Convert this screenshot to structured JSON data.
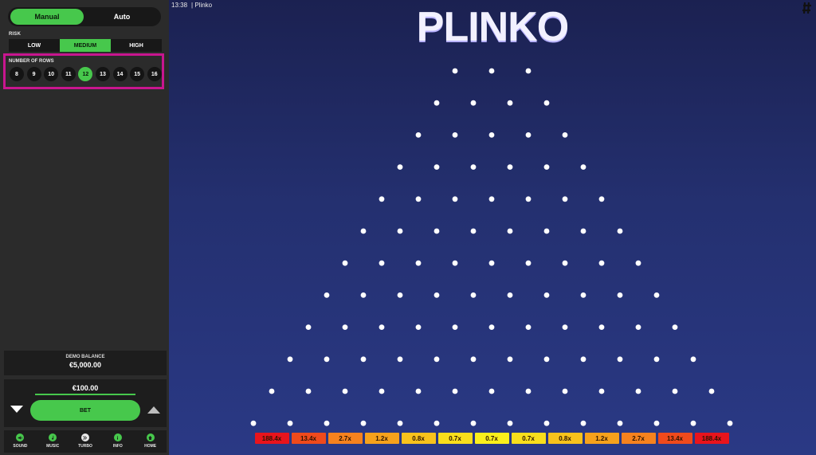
{
  "sidebar": {
    "mode_tabs": [
      {
        "label": "Manual",
        "active": true
      },
      {
        "label": "Auto",
        "active": false
      }
    ],
    "risk": {
      "label": "RISK",
      "options": [
        {
          "label": "LOW",
          "active": false
        },
        {
          "label": "MEDIUM",
          "active": true
        },
        {
          "label": "HIGH",
          "active": false
        }
      ]
    },
    "rows": {
      "label": "NUMBER OF ROWS",
      "options": [
        "8",
        "9",
        "10",
        "11",
        "12",
        "13",
        "14",
        "15",
        "16"
      ],
      "selected": "12"
    },
    "balance": {
      "label": "DEMO BALANCE",
      "value": "€5,000.00"
    },
    "bet": {
      "amount": "€100.00",
      "button_label": "BET",
      "slider_fill": 1.0
    },
    "bottom_bar": [
      {
        "label": "SOUND",
        "icon": "sound-icon"
      },
      {
        "label": "MUSIC",
        "icon": "music-icon"
      },
      {
        "label": "TURBO",
        "icon": "turbo-icon"
      },
      {
        "label": "INFO",
        "icon": "info-icon"
      },
      {
        "label": "HOME",
        "icon": "home-icon"
      }
    ]
  },
  "game": {
    "time": "13:38",
    "title": "| Plinko",
    "logo": "PLINKO",
    "peg_rows": 12,
    "first_row_pegs": 3,
    "multipliers": [
      "188.4x",
      "13.4x",
      "2.7x",
      "1.2x",
      "0.8x",
      "0.7x",
      "0.7x",
      "0.7x",
      "0.8x",
      "1.2x",
      "2.7x",
      "13.4x",
      "188.4x"
    ],
    "multiplier_colors": [
      "#e8141d",
      "#ef4a1c",
      "#f6821e",
      "#f7a21c",
      "#f8c21c",
      "#f9de1c",
      "#fbef1c",
      "#f9de1c",
      "#f8c21c",
      "#f7a21c",
      "#f6821e",
      "#ef4a1c",
      "#e8141d"
    ]
  },
  "colors": {
    "accent": "#47c84c",
    "highlight": "#c8168f",
    "panel": "#2b2b2b"
  }
}
